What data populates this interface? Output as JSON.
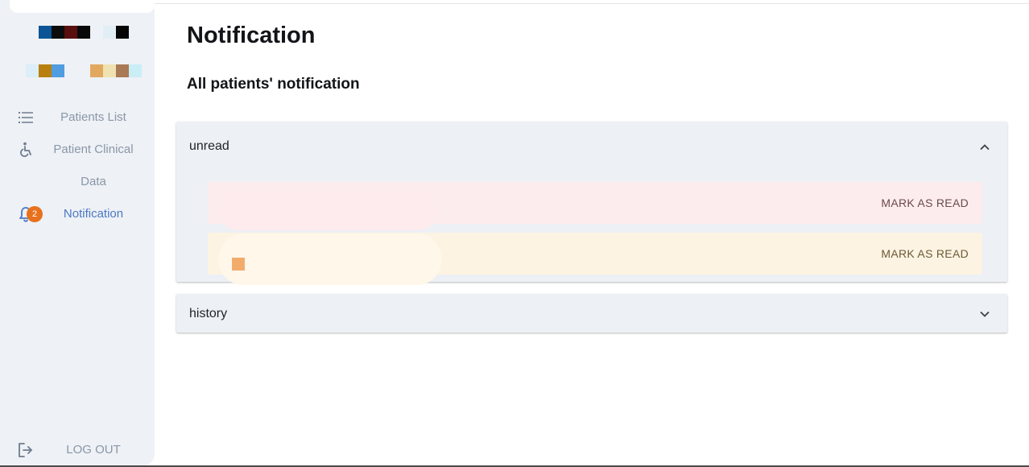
{
  "sidebar": {
    "items": [
      {
        "label": "Patients List",
        "icon": "list-icon"
      },
      {
        "label": "Patient Clinical Data",
        "icon": "accessible-icon"
      },
      {
        "label": "Notification",
        "icon": "bell-icon",
        "badge": "2",
        "active": true
      }
    ],
    "logout_label": "LOG OUT"
  },
  "main": {
    "title": "Notification",
    "subtitle": "All patients' notification",
    "sections": [
      {
        "label": "unread",
        "expanded": true,
        "notifications": [
          {
            "action_label": "MARK AS READ",
            "color": "#fdeced",
            "text_color": "#6b4a4a"
          },
          {
            "action_label": "MARK AS READ",
            "color": "#fdf3e2",
            "text_color": "#6b5a36"
          }
        ]
      },
      {
        "label": "history",
        "expanded": false
      }
    ]
  },
  "colors": {
    "accent": "#4b79c4",
    "badge": "#e8711d",
    "sidebar_bg": "#eef1f5",
    "panel_bg": "#edf0f5"
  }
}
